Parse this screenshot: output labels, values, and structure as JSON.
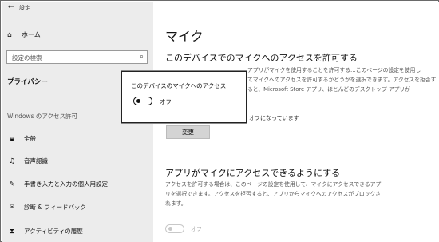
{
  "window": {
    "title": "設定"
  },
  "sidebar": {
    "home_label": "ホーム",
    "search_placeholder": "設定の検索",
    "section_title": "プライバシー",
    "group_label": "Windows のアクセス許可",
    "items": [
      {
        "label": "全般",
        "icon": "lock-icon"
      },
      {
        "label": "音声認識",
        "icon": "speech-icon"
      },
      {
        "label": "手書き入力と入力の個人用設定",
        "icon": "pen-icon"
      },
      {
        "label": "診断 & フィードバック",
        "icon": "feedback-icon"
      },
      {
        "label": "アクティビティの履歴",
        "icon": "history-icon"
      }
    ]
  },
  "main": {
    "title": "マイク",
    "device_heading": "このデバイスでのマイクへのアクセスを許可する",
    "device_desc_line1": "アプリがマイクを使用することを許可する…このページの設定を使用し",
    "device_desc_line2": "てマイクへのアクセスを許可するかどうかを選択できます。アクセスを拒否す",
    "device_desc_line3": "ると、Microsoft Store アプリ、ほとんどのデスクトップ アプリが",
    "device_status": "オフになっています",
    "change_button": "変更",
    "apps_heading": "アプリがマイクにアクセスできるようにする",
    "apps_desc_line1": "アクセスを許可する場合は、このページの設定を使用して、マイクにアクセスできるアプ",
    "apps_desc_line2": "リを選択できます。アクセスを拒否すると、アプリからマイクへのアクセスがブロックさ",
    "apps_desc_line3": "れます。",
    "apps_toggle_label": "オフ"
  },
  "dialog": {
    "title": "このデバイスのマイクへのアクセス",
    "toggle_label": "オフ",
    "toggle_state": "off"
  }
}
